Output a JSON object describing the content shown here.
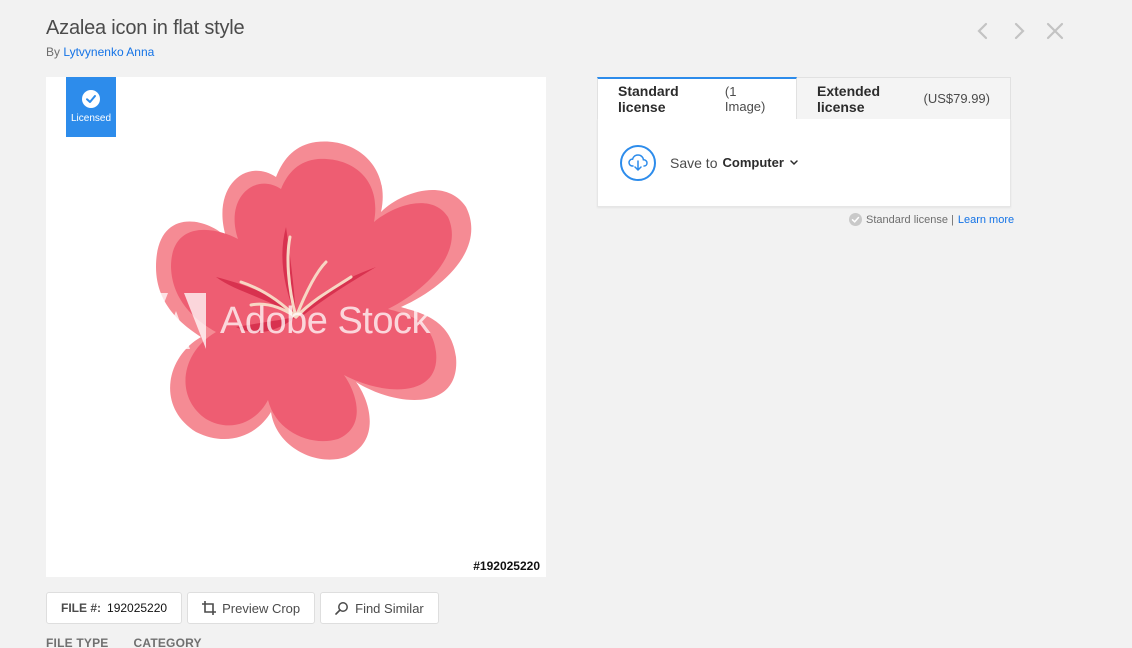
{
  "header": {
    "title": "Azalea icon in flat style",
    "by_prefix": "By",
    "author": "Lytvynenko Anna"
  },
  "nav": {
    "prev_icon": "chevron-left-icon",
    "next_icon": "chevron-right-icon",
    "close_icon": "close-icon"
  },
  "preview": {
    "badge_label": "Licensed",
    "file_id_label": "#192025220",
    "watermark_text": "Adobe Stock"
  },
  "actions": {
    "file_label": "FILE #:",
    "file_value": "192025220",
    "preview_crop": "Preview Crop",
    "find_similar": "Find Similar"
  },
  "meta": {
    "file_type": "FILE TYPE",
    "category": "CATEGORY"
  },
  "license": {
    "standard_tab": "Standard license",
    "standard_sub": "(1 Image)",
    "extended_tab": "Extended license",
    "extended_sub": "(US$79.99)",
    "save_to": "Save to",
    "destination": "Computer",
    "note": "Standard license |",
    "learn_more": "Learn more"
  },
  "colors": {
    "accent": "#2d8ceb",
    "link": "#1473e6",
    "petal_outer": "#f07a87",
    "petal_inner": "#ef5a6f"
  }
}
